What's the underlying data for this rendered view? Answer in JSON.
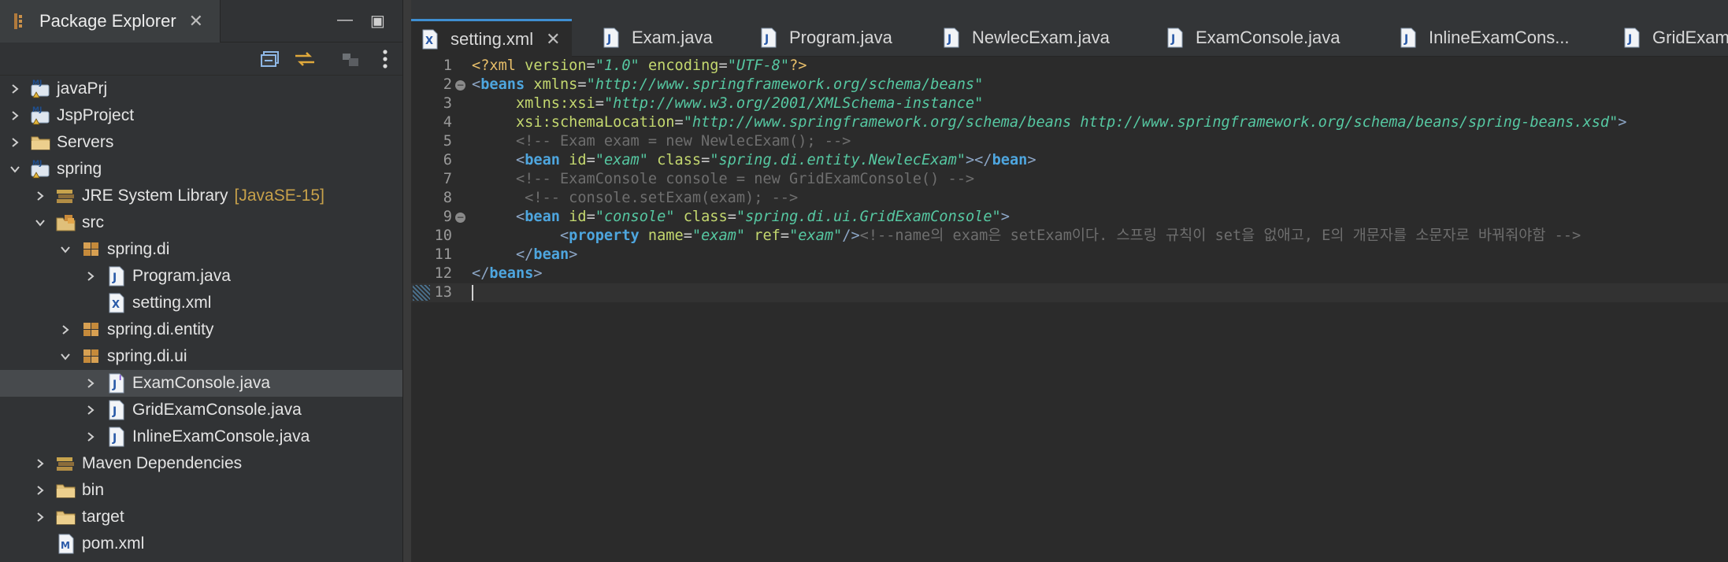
{
  "explorer": {
    "title": "Package Explorer",
    "tree": [
      {
        "label": "javaPrj",
        "depth": 0,
        "expanded": false,
        "icon": "java-project-icon"
      },
      {
        "label": "JspProject",
        "depth": 0,
        "expanded": false,
        "icon": "java-project-icon"
      },
      {
        "label": "Servers",
        "depth": 0,
        "expanded": false,
        "icon": "folder-icon"
      },
      {
        "label": "spring",
        "depth": 0,
        "expanded": true,
        "icon": "java-project-icon"
      },
      {
        "label": "JRE System Library",
        "decor": "[JavaSE-15]",
        "depth": 1,
        "expanded": false,
        "icon": "library-icon"
      },
      {
        "label": "src",
        "depth": 1,
        "expanded": true,
        "icon": "source-folder-icon"
      },
      {
        "label": "spring.di",
        "depth": 2,
        "expanded": true,
        "icon": "package-icon"
      },
      {
        "label": "Program.java",
        "depth": 3,
        "expanded": false,
        "icon": "java-file-icon"
      },
      {
        "label": "setting.xml",
        "depth": 3,
        "leaf": true,
        "icon": "xml-file-icon"
      },
      {
        "label": "spring.di.entity",
        "depth": 2,
        "expanded": false,
        "icon": "package-icon"
      },
      {
        "label": "spring.di.ui",
        "depth": 2,
        "expanded": true,
        "icon": "package-icon"
      },
      {
        "label": "ExamConsole.java",
        "depth": 3,
        "expanded": false,
        "icon": "java-interface-icon",
        "selected": true
      },
      {
        "label": "GridExamConsole.java",
        "depth": 3,
        "expanded": false,
        "icon": "java-file-icon"
      },
      {
        "label": "InlineExamConsole.java",
        "depth": 3,
        "expanded": false,
        "icon": "java-file-icon"
      },
      {
        "label": "Maven Dependencies",
        "depth": 1,
        "expanded": false,
        "icon": "library-icon"
      },
      {
        "label": "bin",
        "depth": 1,
        "expanded": false,
        "icon": "folder-icon"
      },
      {
        "label": "target",
        "depth": 1,
        "expanded": false,
        "icon": "folder-icon"
      },
      {
        "label": "pom.xml",
        "depth": 1,
        "leaf": true,
        "icon": "maven-file-icon"
      }
    ]
  },
  "editor": {
    "tabs": [
      {
        "label": "setting.xml",
        "icon": "xml-file-icon",
        "active": true
      },
      {
        "label": "Exam.java",
        "icon": "java-file-icon"
      },
      {
        "label": "Program.java",
        "icon": "java-file-icon"
      },
      {
        "label": "NewlecExam.java",
        "icon": "java-file-icon"
      },
      {
        "label": "ExamConsole.java",
        "icon": "java-file-icon"
      },
      {
        "label": "InlineExamCons...",
        "icon": "java-file-icon"
      },
      {
        "label": "GridExamC",
        "icon": "java-file-icon"
      }
    ],
    "lines": [
      {
        "n": "1",
        "tokens": [
          [
            "pi",
            "<?"
          ],
          [
            "pi",
            "xml "
          ],
          [
            "attr",
            "version"
          ],
          [
            "eq",
            "="
          ],
          [
            "val",
            "\"1.0\""
          ],
          [
            "eq",
            " "
          ],
          [
            "attr",
            "encoding"
          ],
          [
            "eq",
            "="
          ],
          [
            "val",
            "\"UTF-8\""
          ],
          [
            "pi",
            "?>"
          ]
        ]
      },
      {
        "n": "2",
        "fold": true,
        "tokens": [
          [
            "br",
            "<"
          ],
          [
            "tag",
            "beans"
          ],
          [
            "eq",
            " "
          ],
          [
            "attr",
            "xmlns"
          ],
          [
            "eq",
            "="
          ],
          [
            "val",
            "\"http://www.springframework.org/schema/beans\""
          ]
        ]
      },
      {
        "n": "3",
        "tokens": [
          [
            "eq",
            "     "
          ],
          [
            "attr",
            "xmlns:xsi"
          ],
          [
            "eq",
            "="
          ],
          [
            "val",
            "\"http://www.w3.org/2001/XMLSchema-instance\""
          ]
        ]
      },
      {
        "n": "4",
        "tokens": [
          [
            "eq",
            "     "
          ],
          [
            "attr",
            "xsi:schemaLocation"
          ],
          [
            "eq",
            "="
          ],
          [
            "val",
            "\"http://www.springframework.org/schema/beans http://www.springframework.org/schema/beans/spring-beans.xsd\""
          ],
          [
            "br",
            ">"
          ]
        ]
      },
      {
        "n": "5",
        "tokens": [
          [
            "com",
            "     <!-- Exam exam = new NewlecExam(); -->"
          ]
        ]
      },
      {
        "n": "6",
        "tokens": [
          [
            "eq",
            "     "
          ],
          [
            "br",
            "<"
          ],
          [
            "tag",
            "bean"
          ],
          [
            "eq",
            " "
          ],
          [
            "attr",
            "id"
          ],
          [
            "eq",
            "="
          ],
          [
            "val",
            "\"exam\""
          ],
          [
            "eq",
            " "
          ],
          [
            "attr",
            "class"
          ],
          [
            "eq",
            "="
          ],
          [
            "val",
            "\"spring.di.entity.NewlecExam\""
          ],
          [
            "br",
            "></"
          ],
          [
            "tag",
            "bean"
          ],
          [
            "br",
            ">"
          ]
        ]
      },
      {
        "n": "7",
        "tokens": [
          [
            "com",
            "     <!-- ExamConsole console = new GridExamConsole() -->"
          ]
        ]
      },
      {
        "n": "8",
        "tokens": [
          [
            "com",
            "      <!-- console.setExam(exam); -->"
          ]
        ]
      },
      {
        "n": "9",
        "fold": true,
        "tokens": [
          [
            "eq",
            "     "
          ],
          [
            "br",
            "<"
          ],
          [
            "tag",
            "bean"
          ],
          [
            "eq",
            " "
          ],
          [
            "attr",
            "id"
          ],
          [
            "eq",
            "="
          ],
          [
            "val",
            "\"console\""
          ],
          [
            "eq",
            " "
          ],
          [
            "attr",
            "class"
          ],
          [
            "eq",
            "="
          ],
          [
            "val",
            "\"spring.di.ui.GridExamConsole\""
          ],
          [
            "br",
            ">"
          ]
        ]
      },
      {
        "n": "10",
        "tokens": [
          [
            "eq",
            "          "
          ],
          [
            "br",
            "<"
          ],
          [
            "tag",
            "property"
          ],
          [
            "eq",
            " "
          ],
          [
            "attr",
            "name"
          ],
          [
            "eq",
            "="
          ],
          [
            "val",
            "\"exam\""
          ],
          [
            "eq",
            " "
          ],
          [
            "attr",
            "ref"
          ],
          [
            "eq",
            "="
          ],
          [
            "val",
            "\"exam\""
          ],
          [
            "br",
            "/>"
          ],
          [
            "com",
            "<!--name의 exam은 setExam이다. 스프링 규칙이 set을 없애고, E의 개문자를 소문자로 바꿔줘야함 -->"
          ]
        ]
      },
      {
        "n": "11",
        "tokens": [
          [
            "eq",
            "     "
          ],
          [
            "br",
            "</"
          ],
          [
            "tag",
            "bean"
          ],
          [
            "br",
            ">"
          ]
        ]
      },
      {
        "n": "12",
        "tokens": [
          [
            "br",
            "</"
          ],
          [
            "tag",
            "beans"
          ],
          [
            "br",
            ">"
          ]
        ]
      },
      {
        "n": "13",
        "tokens": [],
        "current": true
      }
    ]
  }
}
